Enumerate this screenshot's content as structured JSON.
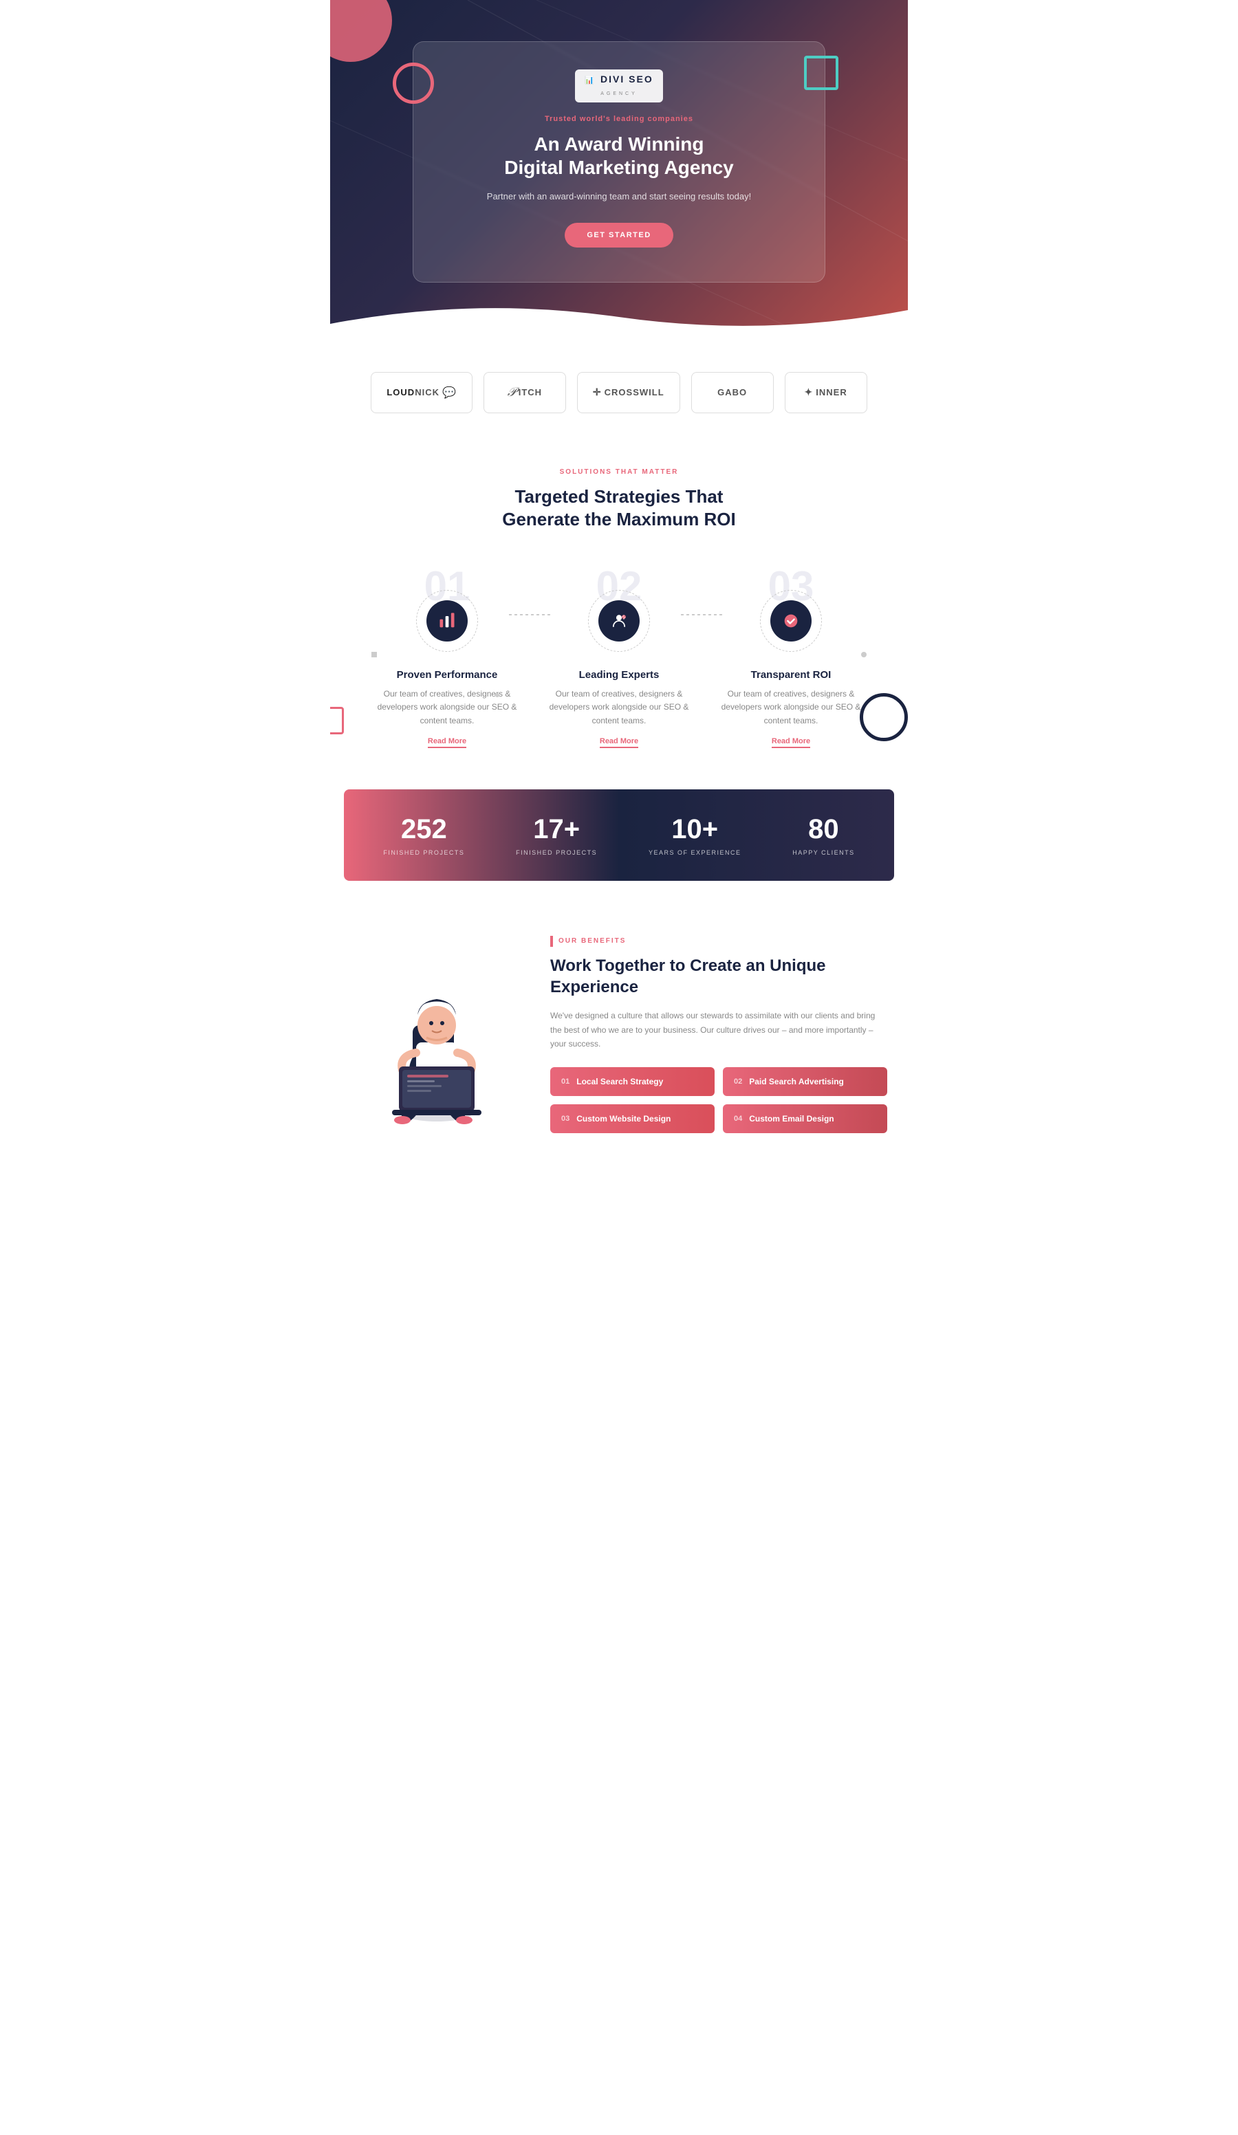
{
  "hero": {
    "logo_text": "DIVI SEO",
    "logo_sub": "AGENCY",
    "trusted_text": "Trusted world's leading companies",
    "title_line1": "An Award Winning",
    "title_line2": "Digital Marketing Agency",
    "subtitle": "Partner with an award-winning team and start seeing results today!",
    "cta_button": "GET STARTED"
  },
  "brands": [
    {
      "name": "LOUDNICK",
      "bold_part": "LOUD"
    },
    {
      "name": "PITCH",
      "bold_part": "P"
    },
    {
      "name": "CROSSWILL",
      "bold_part": "CROSS"
    },
    {
      "name": "GABO",
      "bold_part": "GABO"
    },
    {
      "name": "INNER",
      "bold_part": "INNER"
    }
  ],
  "solutions": {
    "eyebrow": "SOLUTIONS THAT MATTER",
    "title_line1": "Targeted Strategies That",
    "title_line2": "Generate the Maximum ROI"
  },
  "features": [
    {
      "number": "01",
      "title": "Proven Performance",
      "desc": "Our team of creatives, designers & developers work alongside our SEO & content teams.",
      "read_more": "Read More",
      "icon": "bar-chart"
    },
    {
      "number": "02",
      "title": "Leading Experts",
      "desc": "Our team of creatives, designers & developers work alongside our SEO & content teams.",
      "read_more": "Read More",
      "icon": "user-gear"
    },
    {
      "number": "03",
      "title": "Transparent ROI",
      "desc": "Our team of creatives, designers & developers work alongside our SEO & content teams.",
      "read_more": "Read More",
      "icon": "checkmark"
    }
  ],
  "stats": [
    {
      "number": "252",
      "label": "FINISHED PROJECTS"
    },
    {
      "number": "17+",
      "label": "FINISHED PROJECTS"
    },
    {
      "number": "10+",
      "label": "YEARS OF EXPERIENCE"
    },
    {
      "number": "80",
      "label": "HAPPY CLIENTS"
    }
  ],
  "benefits": {
    "eyebrow": "OUR BENEFITS",
    "title_line1": "Work Together to Create an Unique",
    "title_line2": "Experience",
    "desc": "We've designed a culture that allows our stewards to assimilate with our clients and bring the best of who we are to your business. Our culture drives our – and more importantly – your success.",
    "items": [
      {
        "number": "01",
        "label": "Local Search Strategy"
      },
      {
        "number": "02",
        "label": "Paid Search Advertising"
      },
      {
        "number": "03",
        "label": "Custom Website Design"
      },
      {
        "number": "04",
        "label": "Custom Email Design"
      }
    ]
  }
}
